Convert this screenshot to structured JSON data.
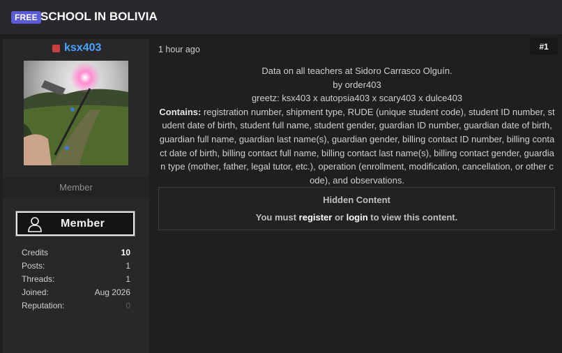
{
  "thread": {
    "badge": "FREE",
    "title": "SCHOOL IN BOLIVIA"
  },
  "user": {
    "name": "ksx403",
    "title": "Member",
    "rank_label": "Member",
    "stats": [
      {
        "label": "Credits",
        "value": "10"
      },
      {
        "label": "Posts:",
        "value": "1"
      },
      {
        "label": "Threads:",
        "value": "1"
      },
      {
        "label": "Joined:",
        "value": "Aug 2026"
      },
      {
        "label": "Reputation:",
        "value": "0"
      }
    ]
  },
  "post": {
    "date": "1 hour ago",
    "number": "#1",
    "line1": "Data on all teachers at Sidoro Carrasco Olguín.",
    "line2": "by order403",
    "line3": "greetz: ksx403 x autopsia403 x scary403 x dulce403",
    "contains_label": "Contains:",
    "contains_text": " registration number, shipment type, RUDE (unique student code), student ID number, student date of birth, student full name, student gender, guardian ID number, guardian date of birth, guardian full name, guardian last name(s), guardian gender, billing contact ID number, billing contact date of birth, billing contact full name, billing contact last name(s), billing contact gender, guardian type (mother, father, legal tutor, etc.), operation (enrollment, modification, cancellation, or other code), and observations."
  },
  "hidden": {
    "title": "Hidden Content",
    "msg_prefix": "You must ",
    "register": "register",
    "msg_or": " or ",
    "login": "login",
    "msg_suffix": " to view this content."
  }
}
